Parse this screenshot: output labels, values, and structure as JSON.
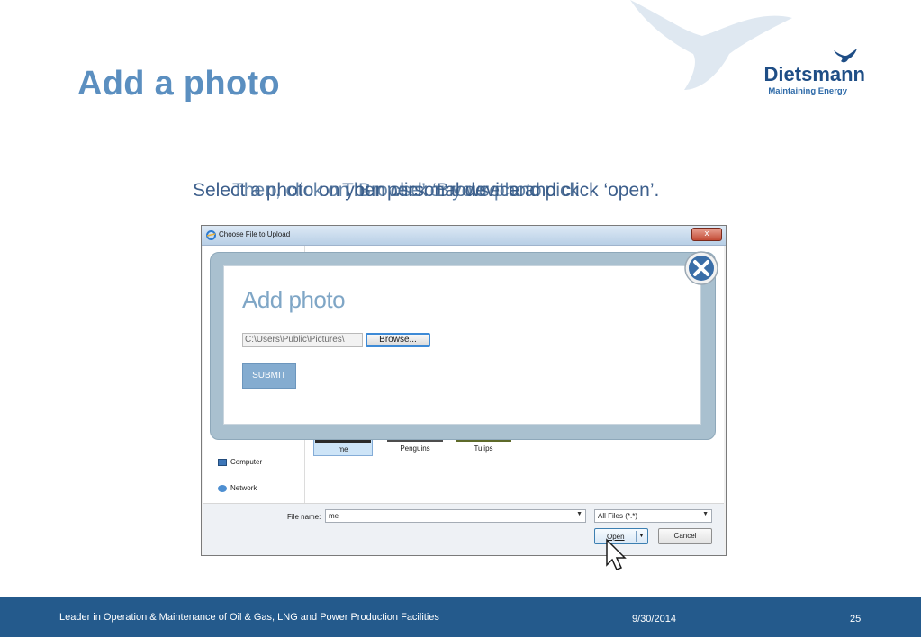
{
  "slide": {
    "title": "Add a photo",
    "logo": {
      "name": "Dietsmann",
      "tagline": "Maintaining Energy"
    },
    "instructions": [
      "Select a photo on your personal device and click ‘open’.",
      "Then, click on ‘Browse’ or your photo",
      "Then click ‘Browse’ and pick"
    ]
  },
  "dialog": {
    "window_title": "Choose File to Upload",
    "close_glyph": "x",
    "nav": {
      "computer": "Computer",
      "network": "Network"
    },
    "files": [
      "me",
      "Penguins",
      "Tulips"
    ],
    "file_name_label": "File name:",
    "file_name_value": "me",
    "filter_value": "All Files (*.*)",
    "open_label": "Open",
    "cancel_label": "Cancel"
  },
  "modal": {
    "title": "Add photo",
    "path_value": "C:\\Users\\Public\\Pictures\\",
    "browse_label": "Browse...",
    "submit_label": "SUBMIT"
  },
  "footer": {
    "tagline": "Leader in Operation & Maintenance of Oil & Gas, LNG and Power Production Facilities",
    "date": "9/30/2014",
    "page": "25"
  },
  "colors": {
    "title": "#5b8fc0",
    "footer_bg": "#245a8c",
    "modal_frame": "#a9c0cf",
    "submit_bg": "#84acd0"
  },
  "icons": [
    "bird-watermark",
    "dietsmann-bird-icon",
    "ie-icon",
    "computer-icon",
    "network-icon",
    "modal-close-icon",
    "mouse-cursor-icon"
  ]
}
